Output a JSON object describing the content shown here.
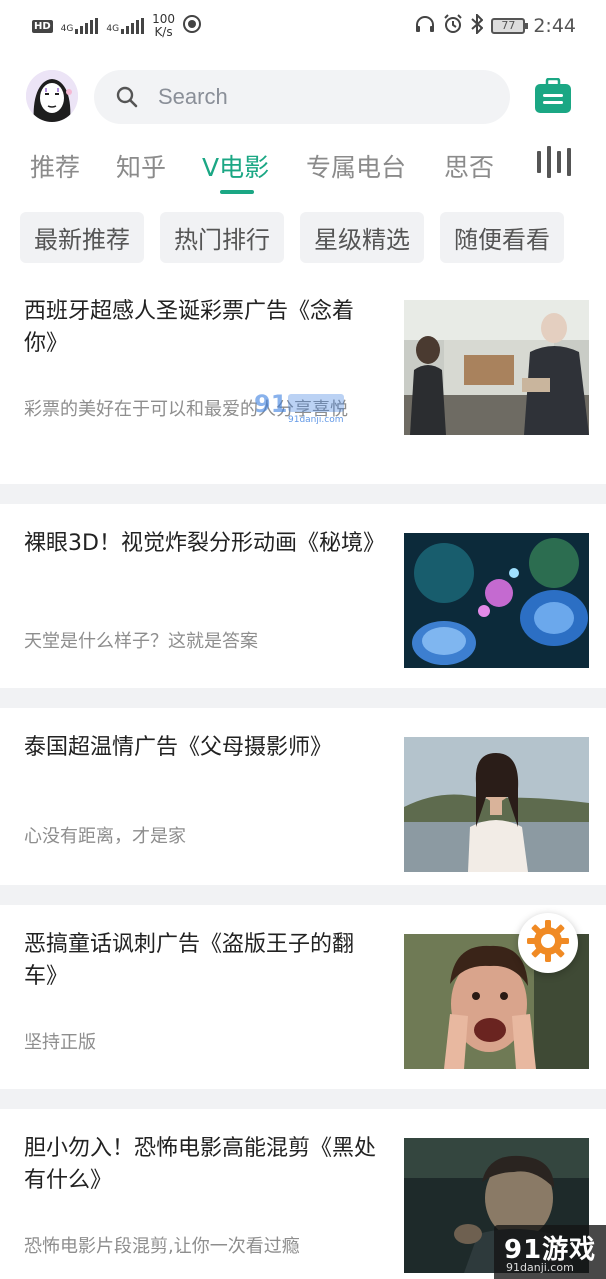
{
  "status_bar": {
    "hd": "HD",
    "net1": "4G",
    "net2": "4G",
    "speed_value": "100",
    "speed_unit": "K/s",
    "battery": "77",
    "time": "2:44"
  },
  "search": {
    "placeholder": "Search"
  },
  "tabs": [
    {
      "label": "推荐",
      "active": false
    },
    {
      "label": "知乎",
      "active": false
    },
    {
      "label": "V电影",
      "active": true
    },
    {
      "label": "专属电台",
      "active": false
    },
    {
      "label": "思否",
      "active": false
    }
  ],
  "chips": [
    "最新推荐",
    "热门排行",
    "星级精选",
    "随便看看"
  ],
  "articles": [
    {
      "title": "西班牙超感人圣诞彩票广告《念着你》",
      "subtitle": "彩票的美好在于可以和最爱的人分享喜悦"
    },
    {
      "title": "裸眼3D！视觉炸裂分形动画《秘境》",
      "subtitle": "天堂是什么样子？这就是答案"
    },
    {
      "title": "泰国超温情广告《父母摄影师》",
      "subtitle": "心没有距离，才是家"
    },
    {
      "title": "恶搞童话讽刺广告《盗版王子的翻车》",
      "subtitle": "坚持正版"
    },
    {
      "title": "胆小勿入！恐怖电影高能混剪《黑处有什么》",
      "subtitle": "恐怖电影片段混剪,让你一次看过瘾"
    }
  ],
  "watermark": {
    "center_site": "91danji.com",
    "logo": "91游戏",
    "site": "91danji.com"
  },
  "colors": {
    "accent": "#1ba784",
    "fab": "#f08a24"
  }
}
